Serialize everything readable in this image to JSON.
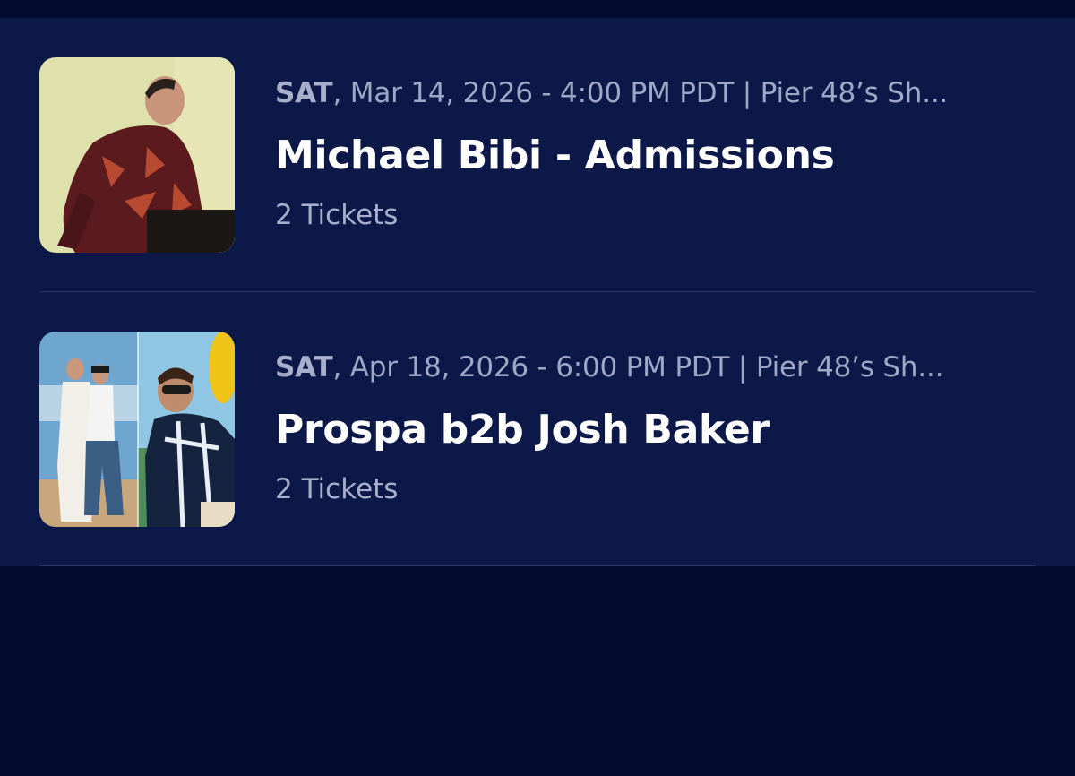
{
  "events": [
    {
      "day": "SAT",
      "details": ", Mar 14, 2026 - 4:00 PM PDT | Pier 48’s Sh...",
      "title": "Michael Bibi - Admissions",
      "tickets": "2 Tickets"
    },
    {
      "day": "SAT",
      "details": ", Apr 18, 2026 - 6:00 PM PDT | Pier 48’s Sh...",
      "title": "Prospa b2b Josh Baker",
      "tickets": "2 Tickets"
    }
  ],
  "colors": {
    "background": "#020a2e",
    "panel": "#0c1847",
    "title_text": "#ffffff",
    "secondary_text": "#a7afcc",
    "divider": "#2a3564"
  }
}
